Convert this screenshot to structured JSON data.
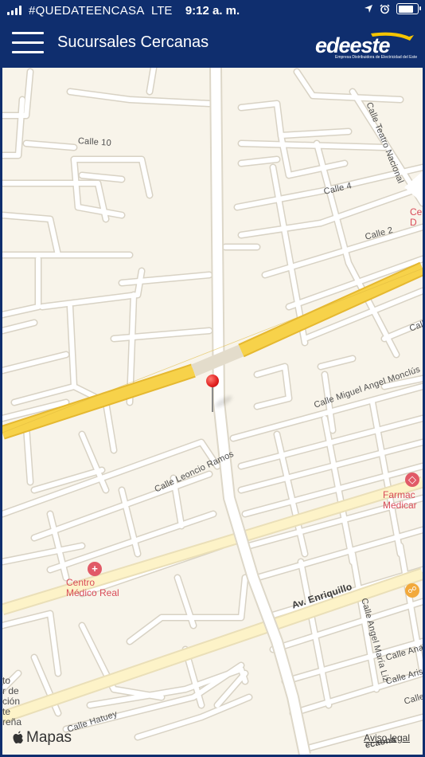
{
  "status_bar": {
    "carrier": "#QUEDATEENCASA",
    "network": "LTE",
    "time": "9:12 a. m.",
    "icons": [
      "location-arrow-icon",
      "alarm-icon",
      "battery-icon"
    ],
    "battery_level": 0.85
  },
  "header": {
    "title": "Sucursales Cercanas",
    "menu_icon": "hamburger-menu-icon",
    "logo": {
      "text": "edeeste",
      "tagline": "Empresa Distribuidora de Electricidad del Este"
    },
    "background_color": "#0f2e6e",
    "accent_color": "#f5c400"
  },
  "map": {
    "streets": {
      "calle_10": "Calle 10",
      "calle_teatro_nacional": "Calle Teatro Nacional",
      "calle_4": "Calle 4",
      "calle_2": "Calle 2",
      "calle_miguel": "Calle Miguel Angel Monclús",
      "calle_leoncio": "Calle Leoncio Ramos",
      "av_enriquillo": "Av. Enriquillo",
      "calle_angel": "Calle Angel María Liz",
      "calle_hatuey": "Calle Hatuey",
      "calle_ana": "Calle Ana",
      "calle_aris": "Calle Aris",
      "calle_partial": "Calle",
      "calle_partial_2": "Calle",
      "bottom_road": "ecaona"
    },
    "pois": {
      "farmacia": "Farmac\nMedicar",
      "centro_medico": "Centro\nMédico Real",
      "left_edge": "to\nr de\nción\nte\nreña",
      "right_top": "Ce\nD"
    },
    "attribution": "Mapas",
    "legal": "Aviso legal",
    "colors": {
      "land": "#f8f4ea",
      "highway": "#f7d24a",
      "major_road": "#fdf3c8",
      "street": "#ffffff",
      "poi": "#d94c59"
    }
  }
}
